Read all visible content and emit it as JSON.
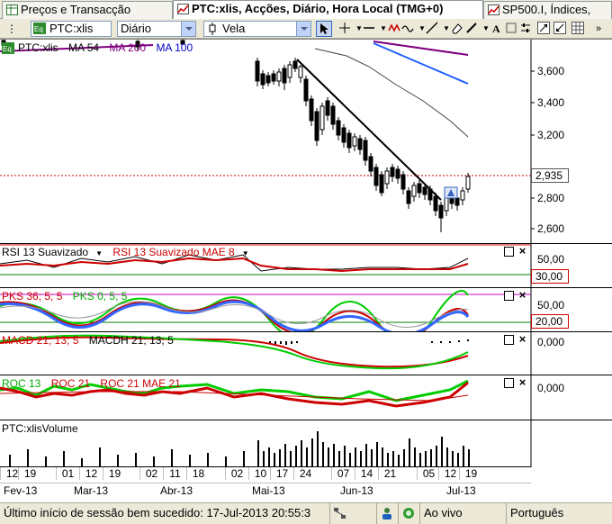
{
  "tabs": [
    {
      "label": "Preços e Transacção",
      "active": false
    },
    {
      "label": "PTC:xlis, Acções, Diário, Hora Local (TMG+0)",
      "active": true
    },
    {
      "label": "SP500.I, Índices,",
      "active": false
    }
  ],
  "toolbar": {
    "symbol": "PTC:xlis",
    "period": "Diário",
    "chart_type": "Vela"
  },
  "price_pane": {
    "legend": [
      "PTC:xlis",
      "MA 54",
      "MA 200",
      "MA 100"
    ],
    "legend_colors": [
      "#000000",
      "#000000",
      "#800080",
      "#0000cc"
    ],
    "axis_labels": [
      "3,600",
      "3,400",
      "3,200",
      "2,800",
      "2,600"
    ],
    "current_price": "2,935"
  },
  "rsi_pane": {
    "legend": [
      "RSI 13 Suavizado",
      "RSI 13 Suavizado MAE 8"
    ],
    "axis_labels": [
      "50,00",
      "30,00"
    ]
  },
  "pks_pane": {
    "legend": [
      "PKS 36; 5; 5",
      "PKS 0; 5; 5"
    ],
    "axis_labels": [
      "50,00",
      "20,00"
    ]
  },
  "macd_pane": {
    "legend": [
      "MACD 21; 13; 5",
      "MACDH 21; 13; 5"
    ],
    "axis_labels": [
      "0,000"
    ]
  },
  "roc_pane": {
    "legend": [
      "ROC 13",
      "ROC 21",
      "ROC 21 MAE 21"
    ],
    "axis_labels": [
      "0,000"
    ]
  },
  "volume_pane": {
    "legend": [
      "PTC:xlisVolume"
    ]
  },
  "x_axis": {
    "days": [
      "12",
      "19",
      "01",
      "12",
      "19",
      "02",
      "11",
      "18",
      "02",
      "10",
      "17",
      "24",
      "07",
      "14",
      "21",
      "05",
      "12",
      "19"
    ],
    "months": [
      "Fev-13",
      "Mar-13",
      "Abr-13",
      "Mai-13",
      "Jun-13",
      "Jul-13"
    ]
  },
  "status_bar": {
    "message": "Último início de sessão bem sucedido: 17-Jul-2013 20:55:3",
    "connection": "Ao vivo",
    "language": "Português"
  }
}
